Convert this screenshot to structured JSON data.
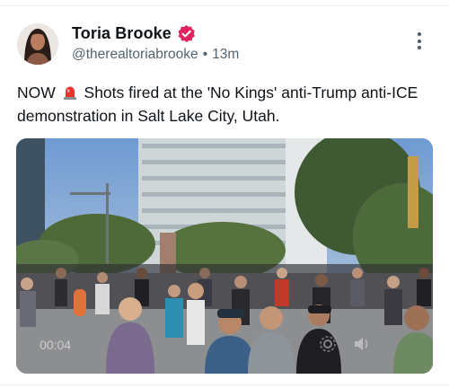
{
  "post": {
    "author": {
      "display_name": "Toria Brooke",
      "handle": "@therealtoriabrooke",
      "verified_icon": "verified-badge-icon",
      "avatar": "avatar"
    },
    "meta_separator": "•",
    "time_ago": "13m",
    "text_prefix": "NOW",
    "text_emoji": "siren-icon",
    "text_body": "Shots fired at the 'No Kings' anti-Trump anti-ICE demonstration in Salt Lake City, Utah.",
    "video": {
      "timestamp": "00:04",
      "settings_icon": "gear-icon",
      "volume_icon": "volume-icon"
    }
  },
  "colors": {
    "verified_badge": "#e0245e",
    "text_primary": "#0f1419",
    "text_secondary": "#536471"
  }
}
